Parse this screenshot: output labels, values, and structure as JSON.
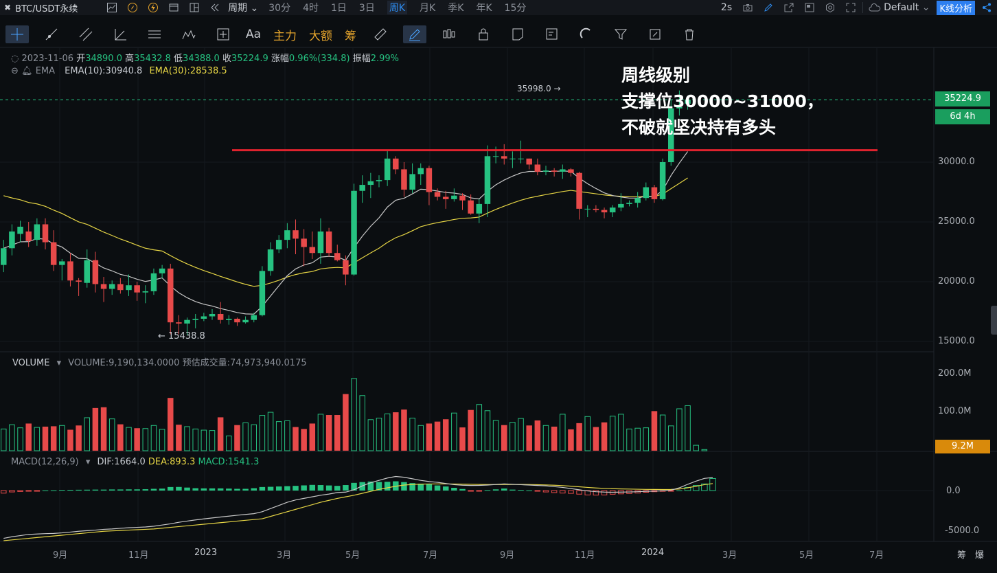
{
  "topbar": {
    "symbol": "BTC/USDT永续",
    "period_menu": "周期",
    "periods": [
      "30分",
      "4时",
      "1日",
      "3日",
      "周K",
      "月K",
      "季K",
      "年K",
      "15分"
    ],
    "active_period": "周K",
    "refresh": "2s",
    "theme": "Default",
    "analysis_button": "K线分析"
  },
  "toolbar": {
    "text_tool": "Aa",
    "main_force": "主力",
    "big_order": "大额",
    "chips": "筹"
  },
  "candle_info": {
    "date": "2023-11-06",
    "open_label": "开",
    "open": "34890.0",
    "high_label": "高",
    "high": "35432.8",
    "low_label": "低",
    "low": "34388.0",
    "close_label": "收",
    "close": "35224.9",
    "change_label": "涨幅",
    "change": "0.96%(334.8)",
    "amp_label": "振幅",
    "amp": "2.99%"
  },
  "ema": {
    "label": "EMA",
    "ema10": "EMA(10):30940.8",
    "ema30": "EMA(30):28538.5"
  },
  "annotation": {
    "line1": "周线级别",
    "line2": "支撑位30000~31000，",
    "line3": "不破就坚决持有多头"
  },
  "price_axis": {
    "labels": [
      "30000.0",
      "25000.0",
      "20000.0",
      "15000.0"
    ],
    "last_price": "35224.9",
    "countdown": "6d 4h"
  },
  "extremes": {
    "high": "35998.0 →",
    "low": "← 15438.8"
  },
  "volume": {
    "title": "VOLUME",
    "value": "VOLUME:9,190,134.0000",
    "estimate": "预估成交量:74,973,940.0175",
    "axis": [
      "200.0M",
      "100.0M"
    ],
    "last": "9.2M"
  },
  "macd": {
    "title": "MACD(12,26,9)",
    "dif": "DIF:1664.0",
    "dea": "DEA:893.3",
    "macd": "MACD:1541.3",
    "axis": [
      "0.0",
      "-5000.0"
    ]
  },
  "x_axis": [
    "9月",
    "11月",
    "2023",
    "3月",
    "5月",
    "7月",
    "9月",
    "11月",
    "2024",
    "3月",
    "5月",
    "7月"
  ],
  "bottom_right": {
    "a": "筹",
    "b": "爆"
  },
  "colors": {
    "up": "#26c281",
    "down": "#e84a4a",
    "ema10": "#c8c8c8",
    "ema30": "#e6d545",
    "support": "#e0232e",
    "accent": "#2d8cf0"
  },
  "chart_data": {
    "type": "candlestick",
    "interval": "1w",
    "last_candle": {
      "date": "2023-11-06",
      "open": 34890.0,
      "high": 35432.8,
      "low": 34388.0,
      "close": 35224.9
    },
    "support_line": 31000,
    "support_zone": [
      30000,
      31000
    ],
    "price_ylim": [
      14000,
      38000
    ],
    "period_high": 35998.0,
    "period_low": 15438.8,
    "ema10_last": 30940.8,
    "ema30_last": 28538.5,
    "candles": [
      {
        "o": 21400,
        "c": 22800,
        "h": 23500,
        "l": 20800
      },
      {
        "o": 22800,
        "c": 24200,
        "h": 24800,
        "l": 22200
      },
      {
        "o": 24000,
        "c": 24600,
        "h": 25100,
        "l": 23300
      },
      {
        "o": 24200,
        "c": 23400,
        "h": 25000,
        "l": 22900
      },
      {
        "o": 23500,
        "c": 24800,
        "h": 25300,
        "l": 23000
      },
      {
        "o": 24800,
        "c": 23300,
        "h": 25300,
        "l": 22700
      },
      {
        "o": 23300,
        "c": 21400,
        "h": 24300,
        "l": 20900
      },
      {
        "o": 21400,
        "c": 21700,
        "h": 21900,
        "l": 20100
      },
      {
        "o": 21700,
        "c": 20100,
        "h": 22400,
        "l": 19600
      },
      {
        "o": 20100,
        "c": 20000,
        "h": 20300,
        "l": 18800
      },
      {
        "o": 19900,
        "c": 21800,
        "h": 22700,
        "l": 19500
      },
      {
        "o": 21800,
        "c": 19800,
        "h": 22500,
        "l": 19100
      },
      {
        "o": 19800,
        "c": 19400,
        "h": 20400,
        "l": 18300
      },
      {
        "o": 19400,
        "c": 19800,
        "h": 20100,
        "l": 18900
      },
      {
        "o": 19800,
        "c": 19300,
        "h": 20300,
        "l": 19000
      },
      {
        "o": 19300,
        "c": 19700,
        "h": 20600,
        "l": 18800
      },
      {
        "o": 19700,
        "c": 19100,
        "h": 20000,
        "l": 18400
      },
      {
        "o": 19100,
        "c": 19200,
        "h": 19700,
        "l": 18200
      },
      {
        "o": 19200,
        "c": 20700,
        "h": 21100,
        "l": 18900
      },
      {
        "o": 20700,
        "c": 21100,
        "h": 21400,
        "l": 20300
      },
      {
        "o": 21100,
        "c": 16600,
        "h": 21500,
        "l": 15600
      },
      {
        "o": 16600,
        "c": 16500,
        "h": 17200,
        "l": 15600
      },
      {
        "o": 16500,
        "c": 16800,
        "h": 17000,
        "l": 15500
      },
      {
        "o": 16800,
        "c": 16900,
        "h": 17300,
        "l": 16100
      },
      {
        "o": 16900,
        "c": 17100,
        "h": 17400,
        "l": 16700
      },
      {
        "o": 17100,
        "c": 17300,
        "h": 17700,
        "l": 16800
      },
      {
        "o": 17300,
        "c": 16800,
        "h": 18300,
        "l": 16500
      },
      {
        "o": 16800,
        "c": 16900,
        "h": 17200,
        "l": 16400
      },
      {
        "o": 16900,
        "c": 16600,
        "h": 17000,
        "l": 16300
      },
      {
        "o": 16600,
        "c": 16800,
        "h": 17100,
        "l": 16500
      },
      {
        "o": 16800,
        "c": 17200,
        "h": 17400,
        "l": 16600
      },
      {
        "o": 17200,
        "c": 20900,
        "h": 21300,
        "l": 17100
      },
      {
        "o": 20900,
        "c": 22700,
        "h": 23300,
        "l": 20500
      },
      {
        "o": 22700,
        "c": 23500,
        "h": 23900,
        "l": 22400
      },
      {
        "o": 23500,
        "c": 24300,
        "h": 24900,
        "l": 22800
      },
      {
        "o": 24300,
        "c": 23600,
        "h": 25200,
        "l": 22300
      },
      {
        "o": 23600,
        "c": 22900,
        "h": 24400,
        "l": 21300
      },
      {
        "o": 22900,
        "c": 22400,
        "h": 24200,
        "l": 21900
      },
      {
        "o": 22400,
        "c": 24200,
        "h": 25300,
        "l": 21500
      },
      {
        "o": 24200,
        "c": 22400,
        "h": 24500,
        "l": 22100
      },
      {
        "o": 22400,
        "c": 21800,
        "h": 23100,
        "l": 21700
      },
      {
        "o": 21800,
        "c": 20600,
        "h": 22200,
        "l": 19700
      },
      {
        "o": 20600,
        "c": 27600,
        "h": 28200,
        "l": 20500
      },
      {
        "o": 27600,
        "c": 28100,
        "h": 28900,
        "l": 26600
      },
      {
        "o": 28100,
        "c": 28400,
        "h": 29100,
        "l": 27000
      },
      {
        "o": 28400,
        "c": 28500,
        "h": 28900,
        "l": 27900
      },
      {
        "o": 28500,
        "c": 30300,
        "h": 31000,
        "l": 28000
      },
      {
        "o": 30300,
        "c": 29400,
        "h": 30500,
        "l": 29000
      },
      {
        "o": 29400,
        "c": 27700,
        "h": 30000,
        "l": 27100
      },
      {
        "o": 27700,
        "c": 29000,
        "h": 29900,
        "l": 27400
      },
      {
        "o": 29000,
        "c": 29500,
        "h": 29900,
        "l": 28100
      },
      {
        "o": 29500,
        "c": 27500,
        "h": 29700,
        "l": 26400
      },
      {
        "o": 27500,
        "c": 27100,
        "h": 27800,
        "l": 26800
      },
      {
        "o": 27100,
        "c": 26900,
        "h": 27600,
        "l": 26100
      },
      {
        "o": 26900,
        "c": 27200,
        "h": 27800,
        "l": 26700
      },
      {
        "o": 27200,
        "c": 26800,
        "h": 27400,
        "l": 26000
      },
      {
        "o": 26800,
        "c": 25700,
        "h": 27300,
        "l": 25600
      },
      {
        "o": 25700,
        "c": 26500,
        "h": 26900,
        "l": 24900
      },
      {
        "o": 26500,
        "c": 30500,
        "h": 31400,
        "l": 25400
      },
      {
        "o": 30500,
        "c": 30500,
        "h": 31300,
        "l": 29900
      },
      {
        "o": 30500,
        "c": 30300,
        "h": 31500,
        "l": 29800
      },
      {
        "o": 30300,
        "c": 30300,
        "h": 30900,
        "l": 29500
      },
      {
        "o": 30300,
        "c": 30300,
        "h": 31800,
        "l": 29900
      },
      {
        "o": 30300,
        "c": 29800,
        "h": 30300,
        "l": 29400
      },
      {
        "o": 29800,
        "c": 29200,
        "h": 30300,
        "l": 28900
      },
      {
        "o": 29200,
        "c": 29300,
        "h": 29700,
        "l": 28900
      },
      {
        "o": 29300,
        "c": 29200,
        "h": 29500,
        "l": 28800
      },
      {
        "o": 29200,
        "c": 29400,
        "h": 29800,
        "l": 28600
      },
      {
        "o": 29400,
        "c": 29100,
        "h": 29500,
        "l": 28800
      },
      {
        "o": 29100,
        "c": 26100,
        "h": 29200,
        "l": 25200
      },
      {
        "o": 26100,
        "c": 26100,
        "h": 26400,
        "l": 25400
      },
      {
        "o": 26100,
        "c": 26000,
        "h": 26400,
        "l": 25800
      },
      {
        "o": 26000,
        "c": 25800,
        "h": 26200,
        "l": 25300
      },
      {
        "o": 25800,
        "c": 26200,
        "h": 26400,
        "l": 25400
      },
      {
        "o": 26200,
        "c": 26500,
        "h": 27400,
        "l": 25900
      },
      {
        "o": 26500,
        "c": 26600,
        "h": 26800,
        "l": 26300
      },
      {
        "o": 26600,
        "c": 27000,
        "h": 27500,
        "l": 26200
      },
      {
        "o": 27000,
        "c": 27900,
        "h": 28300,
        "l": 26800
      },
      {
        "o": 27900,
        "c": 26900,
        "h": 28100,
        "l": 26600
      },
      {
        "o": 26900,
        "c": 30000,
        "h": 30300,
        "l": 26800
      },
      {
        "o": 30000,
        "c": 34500,
        "h": 35200,
        "l": 29700
      },
      {
        "o": 34500,
        "c": 34600,
        "h": 35998,
        "l": 33900
      },
      {
        "o": 34890,
        "c": 35224.9,
        "h": 35432.8,
        "l": 34388
      }
    ],
    "volume_m": [
      56,
      67,
      59,
      70,
      60,
      62,
      63,
      65,
      54,
      65,
      85,
      110,
      112,
      82,
      68,
      60,
      58,
      57,
      65,
      55,
      136,
      67,
      62,
      56,
      53,
      52,
      86,
      38,
      66,
      72,
      67,
      91,
      99,
      75,
      77,
      61,
      56,
      70,
      94,
      92,
      92,
      146,
      186,
      142,
      80,
      84,
      95,
      99,
      106,
      84,
      65,
      70,
      75,
      81,
      97,
      60,
      105,
      119,
      103,
      78,
      66,
      73,
      83,
      65,
      78,
      65,
      62,
      94,
      55,
      71,
      88,
      61,
      73,
      89,
      94,
      56,
      58,
      59,
      102,
      92,
      64,
      108,
      116,
      14,
      3
    ],
    "macd_hist": [
      -330,
      -180,
      -120,
      -40,
      -30,
      30,
      40,
      80,
      90,
      100,
      110,
      120,
      120,
      140,
      140,
      150,
      150,
      170,
      220,
      250,
      450,
      460,
      380,
      300,
      280,
      280,
      280,
      250,
      220,
      220,
      300,
      450,
      480,
      520,
      560,
      600,
      660,
      720,
      700,
      650,
      600,
      700,
      980,
      1080,
      1150,
      1100,
      1120,
      1180,
      1080,
      950,
      880,
      800,
      650,
      520,
      350,
      200,
      -80,
      -30,
      60,
      150,
      260,
      120,
      80,
      30,
      -80,
      -180,
      -260,
      -320,
      -360,
      -460,
      -560,
      -580,
      -560,
      -470,
      -420,
      -380,
      -320,
      -220,
      -150,
      -100,
      -60,
      20,
      400,
      650,
      850,
      1541.3
    ],
    "dif": [
      -6100,
      -5900,
      -5750,
      -5600,
      -5550,
      -5500,
      -5470,
      -5400,
      -5300,
      -5200,
      -5120,
      -5050,
      -4950,
      -4900,
      -4820,
      -4750,
      -4700,
      -4650,
      -4550,
      -4400,
      -4250,
      -4050,
      -3900,
      -3750,
      -3620,
      -3500,
      -3380,
      -3270,
      -3150,
      -3050,
      -2950,
      -2700,
      -2300,
      -1900,
      -1500,
      -1200,
      -1000,
      -800,
      -600,
      -450,
      -250,
      -200,
      100,
      600,
      1000,
      1300,
      1600,
      1800,
      1700,
      1500,
      1300,
      1150,
      1050,
      900,
      750,
      680,
      650,
      660,
      700,
      780,
      850,
      800,
      750,
      700,
      650,
      600,
      500,
      400,
      250,
      100,
      -50,
      -150,
      -200,
      -220,
      -200,
      -180,
      -150,
      -100,
      -80,
      -30,
      50,
      350,
      800,
      1200,
      1550,
      1664
    ],
    "dea": [
      -6400,
      -6300,
      -6200,
      -6100,
      -6000,
      -5900,
      -5800,
      -5700,
      -5600,
      -5500,
      -5400,
      -5300,
      -5200,
      -5150,
      -5100,
      -5050,
      -5000,
      -4950,
      -4900,
      -4800,
      -4700,
      -4600,
      -4500,
      -4400,
      -4300,
      -4200,
      -4100,
      -4000,
      -3900,
      -3800,
      -3700,
      -3600,
      -3300,
      -3000,
      -2700,
      -2400,
      -2100,
      -1800,
      -1500,
      -1250,
      -1000,
      -800,
      -600,
      -350,
      -100,
      150,
      350,
      550,
      700,
      780,
      820,
      840,
      850,
      850,
      840,
      820,
      800,
      780,
      770,
      770,
      775,
      780,
      780,
      770,
      750,
      720,
      680,
      630,
      560,
      480,
      400,
      330,
      280,
      240,
      210,
      190,
      170,
      150,
      140,
      130,
      140,
      200,
      350,
      550,
      750,
      893.3
    ]
  }
}
